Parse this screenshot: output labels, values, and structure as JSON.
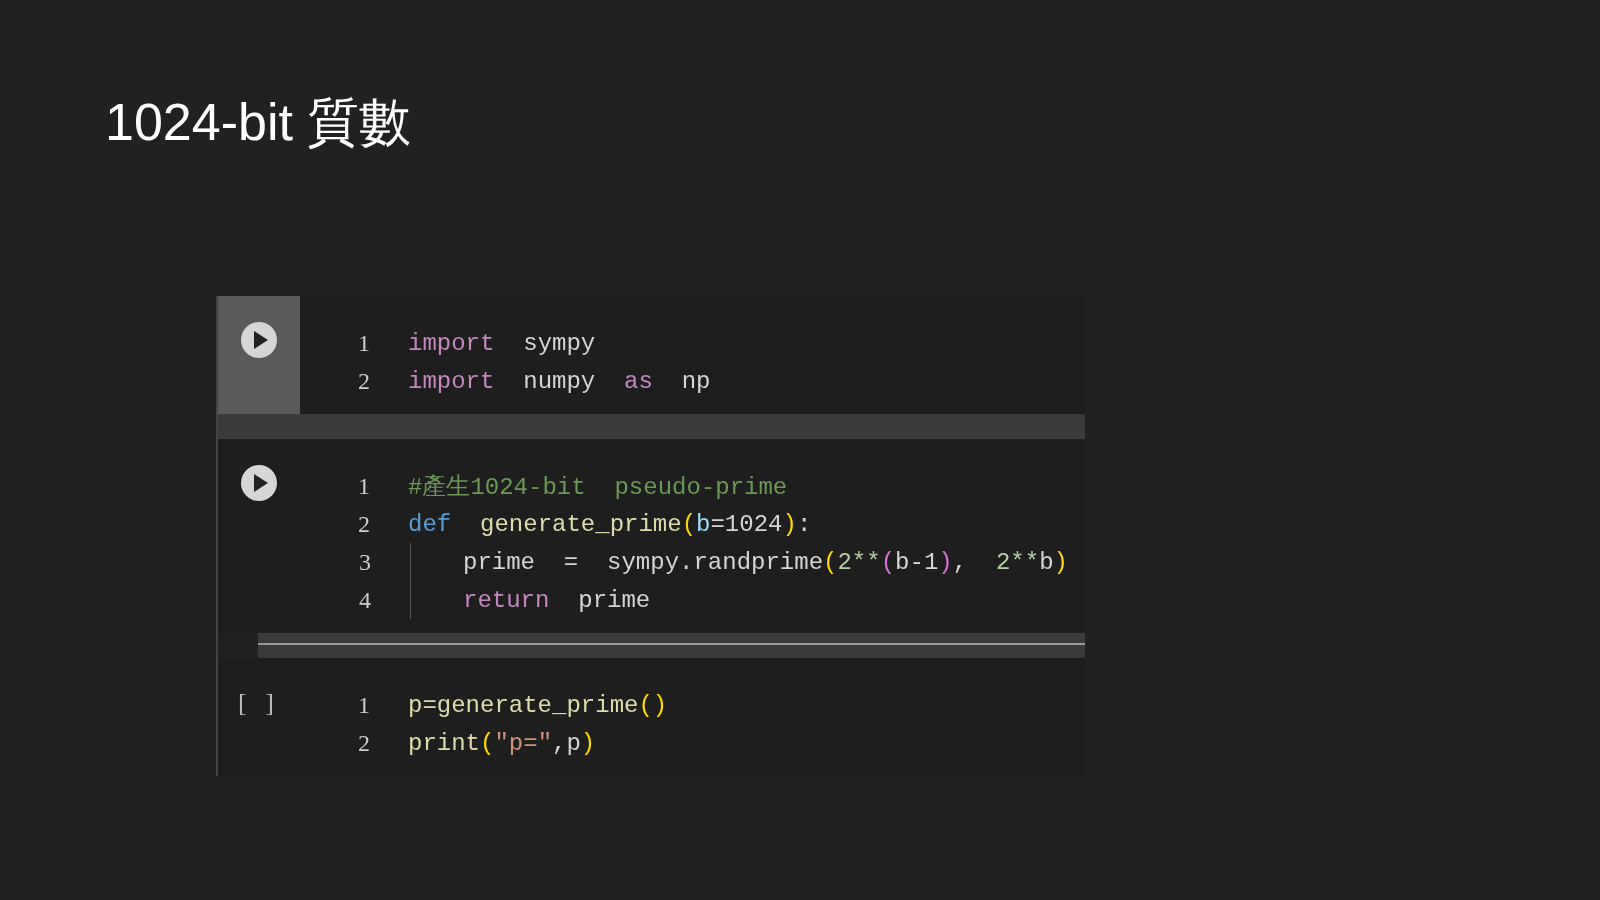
{
  "slide_title": "1024-bit 質數",
  "cells": [
    {
      "kind": "run",
      "selected": true,
      "lines": [
        {
          "number": "1",
          "tokens": [
            {
              "kind": "keyword",
              "text": "import"
            },
            {
              "kind": "plain",
              "text": "  sympy"
            }
          ]
        },
        {
          "number": "2",
          "tokens": [
            {
              "kind": "keyword",
              "text": "import"
            },
            {
              "kind": "plain",
              "text": "  numpy  "
            },
            {
              "kind": "keyword",
              "text": "as"
            },
            {
              "kind": "plain",
              "text": "  np"
            }
          ]
        }
      ]
    },
    {
      "kind": "run",
      "selected": false,
      "lines": [
        {
          "number": "1",
          "tokens": [
            {
              "kind": "comment",
              "text": "#產生1024-bit  pseudo-prime"
            }
          ]
        },
        {
          "number": "2",
          "tokens": [
            {
              "kind": "def",
              "text": "def"
            },
            {
              "kind": "function",
              "text": "  generate_prime"
            },
            {
              "kind": "paren",
              "text": "("
            },
            {
              "kind": "param",
              "text": "b"
            },
            {
              "kind": "plain",
              "text": "=1024"
            },
            {
              "kind": "paren",
              "text": ")"
            },
            {
              "kind": "plain",
              "text": ":"
            }
          ],
          "children": [
            {
              "number": "3",
              "tokens": [
                {
                  "kind": "plain",
                  "text": "prime  =  sympy.randprime"
                },
                {
                  "kind": "paren",
                  "text": "("
                },
                {
                  "kind": "number",
                  "text": "2**"
                },
                {
                  "kind": "paren2",
                  "text": "("
                },
                {
                  "kind": "plain",
                  "text": "b-1"
                },
                {
                  "kind": "paren2",
                  "text": ")"
                },
                {
                  "kind": "plain",
                  "text": ",  "
                },
                {
                  "kind": "number",
                  "text": "2**"
                },
                {
                  "kind": "plain",
                  "text": "b"
                },
                {
                  "kind": "paren",
                  "text": ")"
                }
              ]
            },
            {
              "number": "4",
              "tokens": [
                {
                  "kind": "keyword",
                  "text": "return"
                },
                {
                  "kind": "plain",
                  "text": "  prime"
                }
              ]
            }
          ]
        }
      ]
    },
    {
      "kind": "idle",
      "selected": false,
      "gutter": "[ ]",
      "lines": [
        {
          "number": "1",
          "tokens": [
            {
              "kind": "function",
              "text": "p=generate_prime"
            },
            {
              "kind": "paren",
              "text": "()"
            }
          ]
        },
        {
          "number": "2",
          "tokens": [
            {
              "kind": "function",
              "text": "print"
            },
            {
              "kind": "paren",
              "text": "("
            },
            {
              "kind": "string",
              "text": "″p=″"
            },
            {
              "kind": "plain",
              "text": ",p"
            },
            {
              "kind": "paren",
              "text": ")"
            }
          ]
        }
      ]
    }
  ]
}
